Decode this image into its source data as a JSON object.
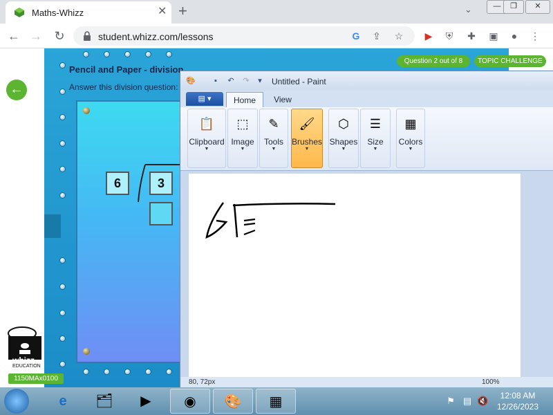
{
  "browser": {
    "tab_title": "Maths-Whizz",
    "tab_close": "✕",
    "new_tab": "+",
    "url": "student.whizz.com/lessons",
    "window_controls": [
      "—",
      "❐",
      "✕"
    ]
  },
  "lesson": {
    "title": "Pencil and Paper - division",
    "instruction": "Answer this division question:",
    "question_counter": "Question 2 out of 8",
    "topic_badge": "TOPIC CHALLENGE",
    "divisor": "6",
    "dividend": "3",
    "answer": "",
    "logo_text": "whizz",
    "logo_sub": "EDUCATION",
    "student_code": "1150MAx0100"
  },
  "paint": {
    "window_title": "Untitled - Paint",
    "tabs": [
      "Home",
      "View"
    ],
    "active_tab": "Home",
    "groups": [
      "Clipboard",
      "Image",
      "Tools",
      "Brushes",
      "Shapes",
      "Size",
      "Colors"
    ],
    "active_group": "Brushes",
    "status_position": "80, 72px",
    "status_zoom": "100%"
  },
  "taskbar": {
    "time": "12:08 AM",
    "date": "12/26/2023"
  },
  "colors": {
    "accent_green": "#5cb531",
    "frame_blue": "#1b8cc7",
    "paint_ribbon": "#dce7f5"
  }
}
